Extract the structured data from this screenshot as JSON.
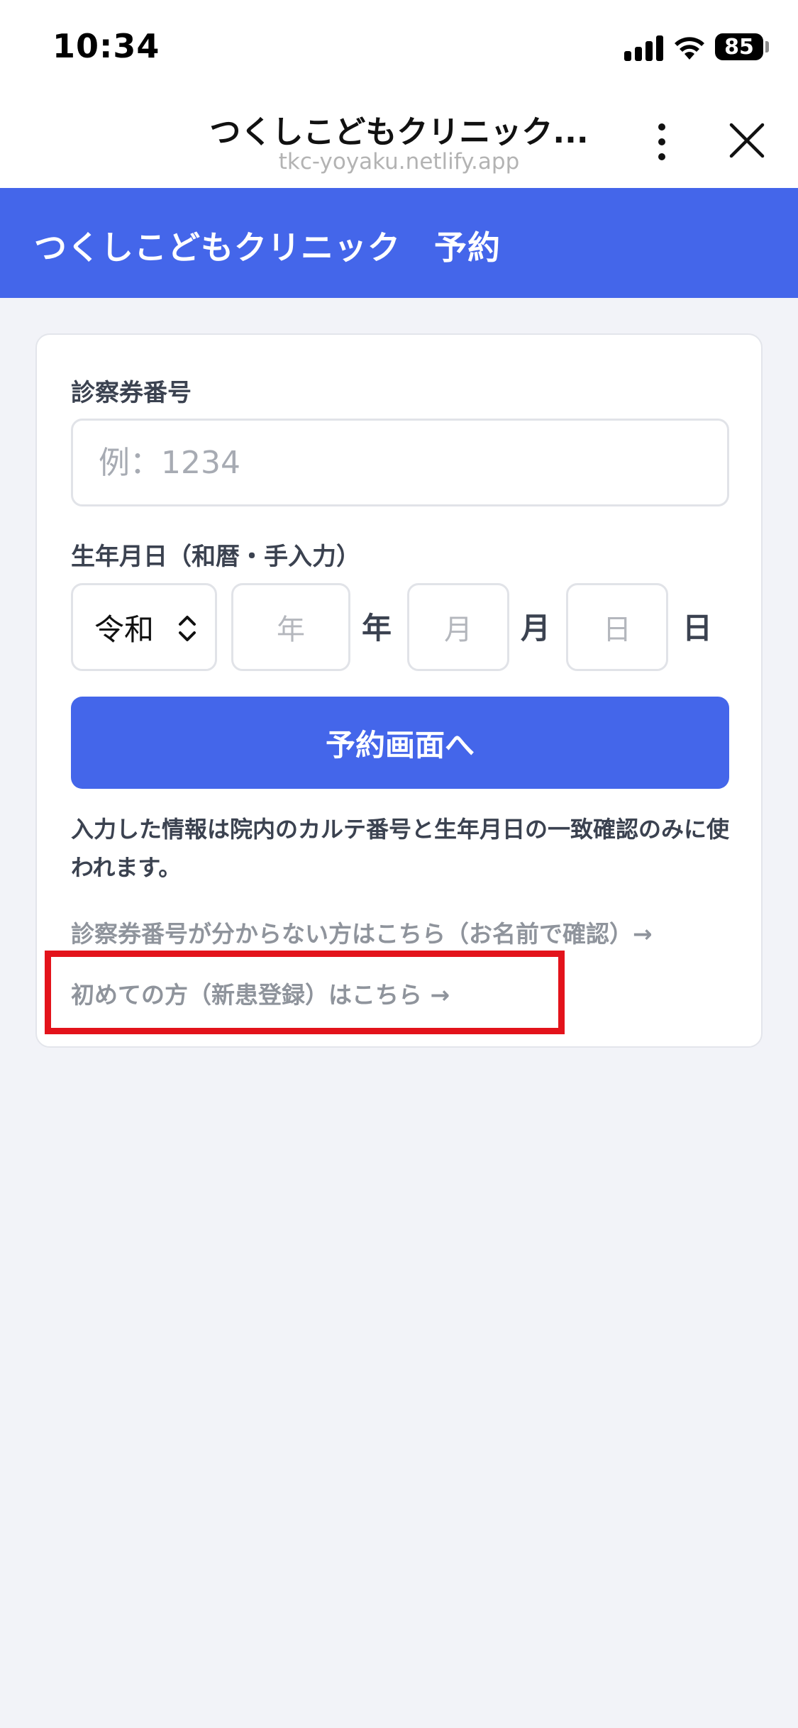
{
  "status": {
    "time": "10:34",
    "battery": "85"
  },
  "browser": {
    "title": "つくしこどもクリニック...",
    "url": "tkc-yoyaku.netlify.app"
  },
  "header": {
    "title": "つくしこどもクリニック　予約"
  },
  "form": {
    "card_number_label": "診察券番号",
    "card_number_placeholder": "例：1234",
    "card_number_value": "",
    "birthdate_label": "生年月日（和暦・手入力）",
    "era_selected": "令和",
    "year_placeholder": "年",
    "year_unit": "年",
    "month_placeholder": "月",
    "month_unit": "月",
    "day_placeholder": "日",
    "day_unit": "日",
    "submit_label": "予約画面へ",
    "note": "入力した情報は院内のカルテ番号と生年月日の一致確認のみに使われます。"
  },
  "links": {
    "forgot_number": "診察券番号が分からない方はこちら（お名前で確認）→",
    "new_patient": "初めての方（新患登録）はこちら →"
  },
  "colors": {
    "brand": "#4466ea",
    "highlight": "#e3131b",
    "background": "#f2f3f8"
  },
  "icons": [
    "signal-icon",
    "wifi-icon",
    "battery-icon",
    "more-vertical-icon",
    "close-icon",
    "chevron-updown-icon"
  ]
}
